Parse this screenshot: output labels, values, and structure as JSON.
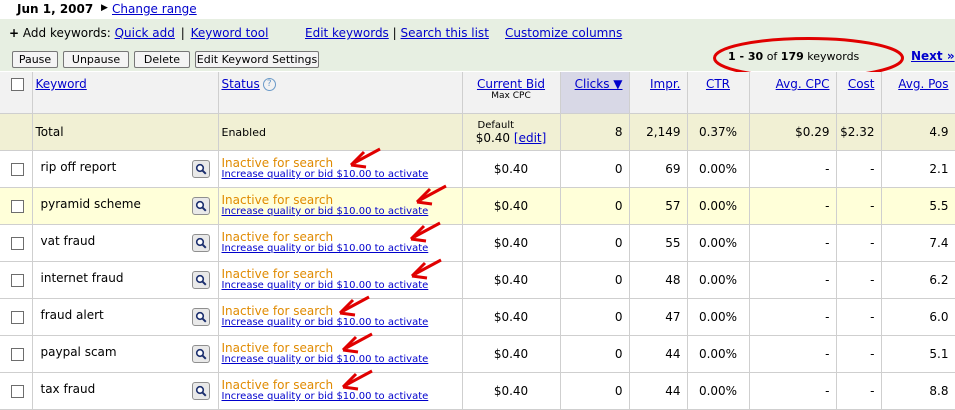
{
  "header": {
    "date": "Jun 1, 2007",
    "change_range": "Change range"
  },
  "addbar": {
    "plus": "+",
    "label": "Add keywords:",
    "quick_add": "Quick add",
    "sep": "|",
    "keyword_tool": "Keyword tool",
    "edit_keywords": "Edit keywords",
    "search_list": "Search this list",
    "customize": "Customize columns"
  },
  "buttons": {
    "pause": "Pause",
    "unpause": "Unpause",
    "delete": "Delete",
    "edit_settings": "Edit Keyword Settings"
  },
  "pagination": {
    "range": "1 - 30",
    "of": "of",
    "total": "179",
    "unit": "keywords",
    "next": "Next »"
  },
  "columns": {
    "keyword": "Keyword",
    "status": "Status",
    "help": "?",
    "bid": "Current Bid",
    "bid_sub": "Max CPC",
    "clicks": "Clicks ▼",
    "impr": "Impr.",
    "ctr": "CTR",
    "cpc": "Avg. CPC",
    "cost": "Cost",
    "pos": "Avg. Pos"
  },
  "total": {
    "label": "Total",
    "status": "Enabled",
    "bid_default": "Default",
    "bid": "$0.40",
    "edit": "[edit]",
    "clicks": "8",
    "impr": "2,149",
    "ctr": "0.37%",
    "cpc": "$0.29",
    "cost": "$2.32",
    "pos": "4.9"
  },
  "rows": [
    {
      "keyword": "rip off report",
      "status": "Inactive for search",
      "action": "Increase quality or bid $10.00 to activate",
      "bid": "$0.40",
      "clicks": "0",
      "impr": "69",
      "ctr": "0.00%",
      "cpc": "-",
      "cost": "-",
      "pos": "2.1"
    },
    {
      "keyword": "pyramid scheme",
      "status": "Inactive for search",
      "action": "Increase quality or bid $10.00 to activate",
      "bid": "$0.40",
      "clicks": "0",
      "impr": "57",
      "ctr": "0.00%",
      "cpc": "-",
      "cost": "-",
      "pos": "5.5"
    },
    {
      "keyword": "vat fraud",
      "status": "Inactive for search",
      "action": "Increase quality or bid $10.00 to activate",
      "bid": "$0.40",
      "clicks": "0",
      "impr": "55",
      "ctr": "0.00%",
      "cpc": "-",
      "cost": "-",
      "pos": "7.4"
    },
    {
      "keyword": "internet fraud",
      "status": "Inactive for search",
      "action": "Increase quality or bid $10.00 to activate",
      "bid": "$0.40",
      "clicks": "0",
      "impr": "48",
      "ctr": "0.00%",
      "cpc": "-",
      "cost": "-",
      "pos": "6.2"
    },
    {
      "keyword": "fraud alert",
      "status": "Inactive for search",
      "action": "Increase quality or bid $10.00 to activate",
      "bid": "$0.40",
      "clicks": "0",
      "impr": "47",
      "ctr": "0.00%",
      "cpc": "-",
      "cost": "-",
      "pos": "6.0"
    },
    {
      "keyword": "paypal scam",
      "status": "Inactive for search",
      "action": "Increase quality or bid $10.00 to activate",
      "bid": "$0.40",
      "clicks": "0",
      "impr": "44",
      "ctr": "0.00%",
      "cpc": "-",
      "cost": "-",
      "pos": "5.1"
    },
    {
      "keyword": "tax fraud",
      "status": "Inactive for search",
      "action": "Increase quality or bid $10.00 to activate",
      "bid": "$0.40",
      "clicks": "0",
      "impr": "44",
      "ctr": "0.00%",
      "cpc": "-",
      "cost": "-",
      "pos": "8.8"
    }
  ],
  "annotation_color": "#e00000",
  "status_color": "#e08a00",
  "link_color": "#0000cc"
}
